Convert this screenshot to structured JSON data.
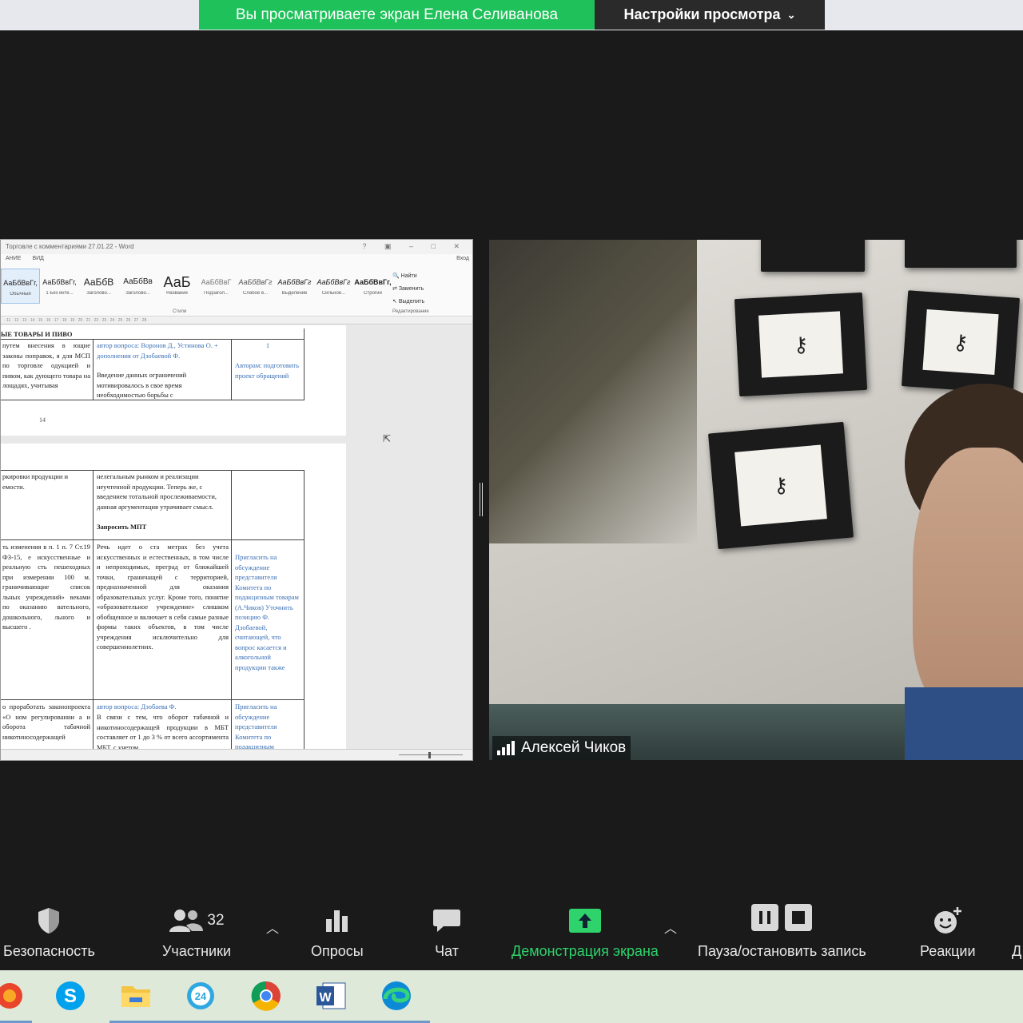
{
  "banner": {
    "sharing_text": "Вы просматриваете экран Елена Селиванова",
    "view_settings": "Настройки просмотра"
  },
  "word": {
    "title": "Торговле с комментариями 27.01.22 - Word",
    "tabs": [
      "АНИЕ",
      "ВИД"
    ],
    "tab_right": "Вход",
    "styles": [
      {
        "sample": "АаБбВвГг,",
        "label": "Обычный"
      },
      {
        "sample": "АаБбВвГг,",
        "label": "1 Без инте..."
      },
      {
        "sample": "АаБбВ",
        "label": "Заголово..."
      },
      {
        "sample": "АаБбВв",
        "label": "Заголово..."
      },
      {
        "sample": "АаБ",
        "label": "Название"
      },
      {
        "sample": "АаБбВвГ",
        "label": "Подзагол..."
      },
      {
        "sample": "АаБбВвГг",
        "label": "Слабое в..."
      },
      {
        "sample": "АаБбВвГг",
        "label": "Выделение"
      },
      {
        "sample": "АаБбВвГг",
        "label": "Сильное..."
      },
      {
        "sample": "АаБбВвГг,",
        "label": "Строгий"
      }
    ],
    "styles_group_label": "Стили",
    "editing": [
      "Найти",
      "Заменить",
      "Выделить"
    ],
    "editing_group_label": "Редактирование",
    "page1": {
      "heading": "ЫЕ ТОВАРЫ И ПИВО",
      "col1": "путем внесения в ющие законы поправок, я для МСП по торговле одукцией и пивом, как дующего товара на лощадях, учитывая",
      "col2_blue": "автор вопроса: Воронов Д., Устинова О. + дополнения от Дзобаевой Ф.",
      "col2_text": "Введение данных ограничений мотивировалось в свое время необходимостью борьбы с",
      "col3_num": "1",
      "col3_text": "Авторам: подготовить проект обращений",
      "page_number": "14"
    },
    "page2": {
      "r1_col1": "ркировки продукции и емости.",
      "r1_col2": "нелегальным рынком и реализации неучтенной продукции. Теперь же, с введением тотальной прослеживаемости, данная аргументация утрачивает смысл.",
      "r1_col2_bold": "Запросить МПТ",
      "r2_col1": "ть изменения в п. 1 п. 7 Ст.19 ФЗ-15, е искусственные и реальную сть пешеходных при измерении 100 м. граничивающие список льных учреждений» веками по оказанию вательного, дошкольного, льного и высшего .",
      "r2_col2": "Речь идет о ста метрах без учета искусственных и естественных, в том числе и непроходимых, преград от ближайшей точки, граничащей с территорией, предназначенной для оказания образовательных услуг. Кроме того, понятие «образовательное учреждение» слишком обобщенное и включает в себя самые разные формы таких объектов, в том числе учреждения исключительно для совершеннолетних.",
      "r2_col3": "Пригласить на обсуждение представителя Комитета по подакцизным товарам (А.Чиков) Уточнить позицию Ф. Дзобаевой, считающей, что вопрос касается и алкогольной продукции также",
      "r3_col1": "о проработать законопроекта «О ном регулировании а и оборота табачной никотиносодержащей",
      "r3_col2_blue": "автор вопроса: Дзобаева Ф.",
      "r3_col2": "В связи с тем, что оборот табачной и никотиносодержащей продукции в МБТ составляет от 1 до 3 % от всего ассортимента МБТ, с учетом",
      "r3_col3": "Пригласить на обсуждение представителя Комитета по подакцизным"
    }
  },
  "video": {
    "participant_name": "Алексей Чиков"
  },
  "toolbar": {
    "security": "Безопасность",
    "participants": "Участники",
    "participants_count": "32",
    "polls": "Опросы",
    "chat": "Чат",
    "share_screen": "Демонстрация экрана",
    "record": "Пауза/остановить запись",
    "reactions": "Реакции",
    "cut_label": "Д"
  },
  "taskbar": {
    "apps": [
      "office-app",
      "skype",
      "file-explorer",
      "app-24",
      "chrome",
      "word",
      "edge"
    ]
  },
  "colors": {
    "banner_green": "#1fc15a",
    "share_green": "#2ed36b",
    "toolbar_bg": "#1a1a1a",
    "taskbar_bg": "#dfe9da"
  }
}
